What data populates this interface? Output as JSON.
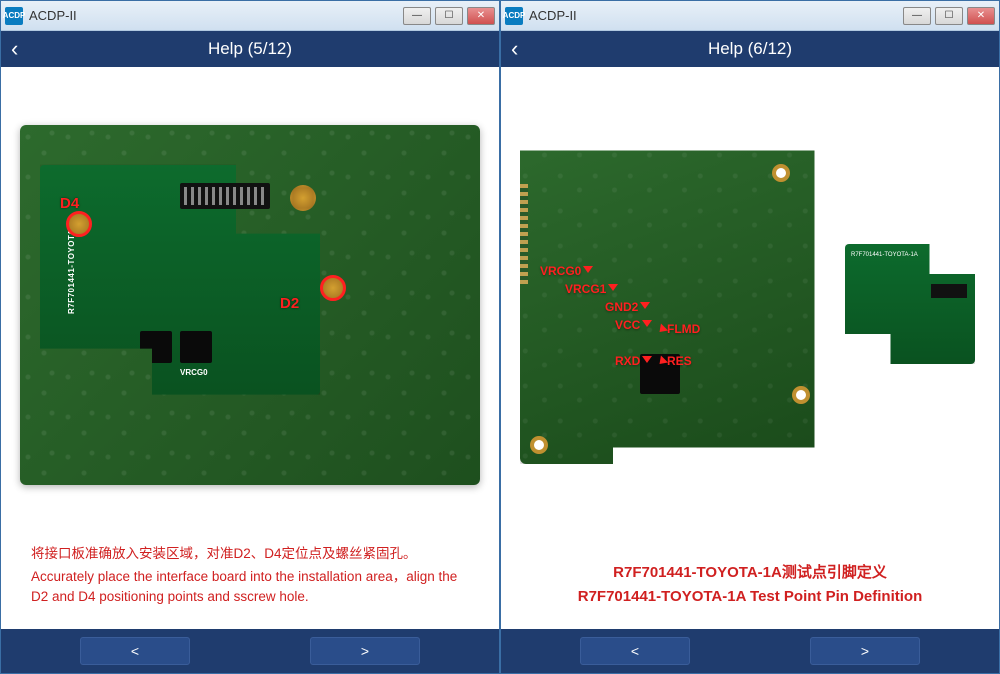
{
  "windows": [
    {
      "app_title": "ACDP-II",
      "app_icon_text": "ACDP",
      "header_title": "Help (5/12)",
      "back_glyph": "‹",
      "prev_glyph": "<",
      "next_glyph": ">",
      "image_labels": {
        "d4": "D4",
        "d2": "D2",
        "board_part": "R7F701441-TOYOTA-1A",
        "vrcg0": "VRCG0"
      },
      "caption_lines": [
        "将接口板准确放入安装区域，对准D2、D4定位点及螺丝紧固孔。",
        "Accurately place the interface board into the installation area，align the D2 and D4 positioning points and sscrew hole."
      ]
    },
    {
      "app_title": "ACDP-II",
      "app_icon_text": "ACDP",
      "header_title": "Help (6/12)",
      "back_glyph": "‹",
      "prev_glyph": "<",
      "next_glyph": ">",
      "pin_labels": {
        "vrcg0": "VRCG0",
        "vrcg1": "VRCG1",
        "gnd2": "GND2",
        "vcc": "VCC",
        "flmd": "FLMD",
        "rxd": "RXD",
        "res": "RES"
      },
      "small_board_label": "R7F701441-TOYOTA-1A",
      "caption_lines": [
        "R7F701441-TOYOTA-1A测试点引脚定义",
        "R7F701441-TOYOTA-1A Test Point Pin Definition"
      ]
    }
  ]
}
